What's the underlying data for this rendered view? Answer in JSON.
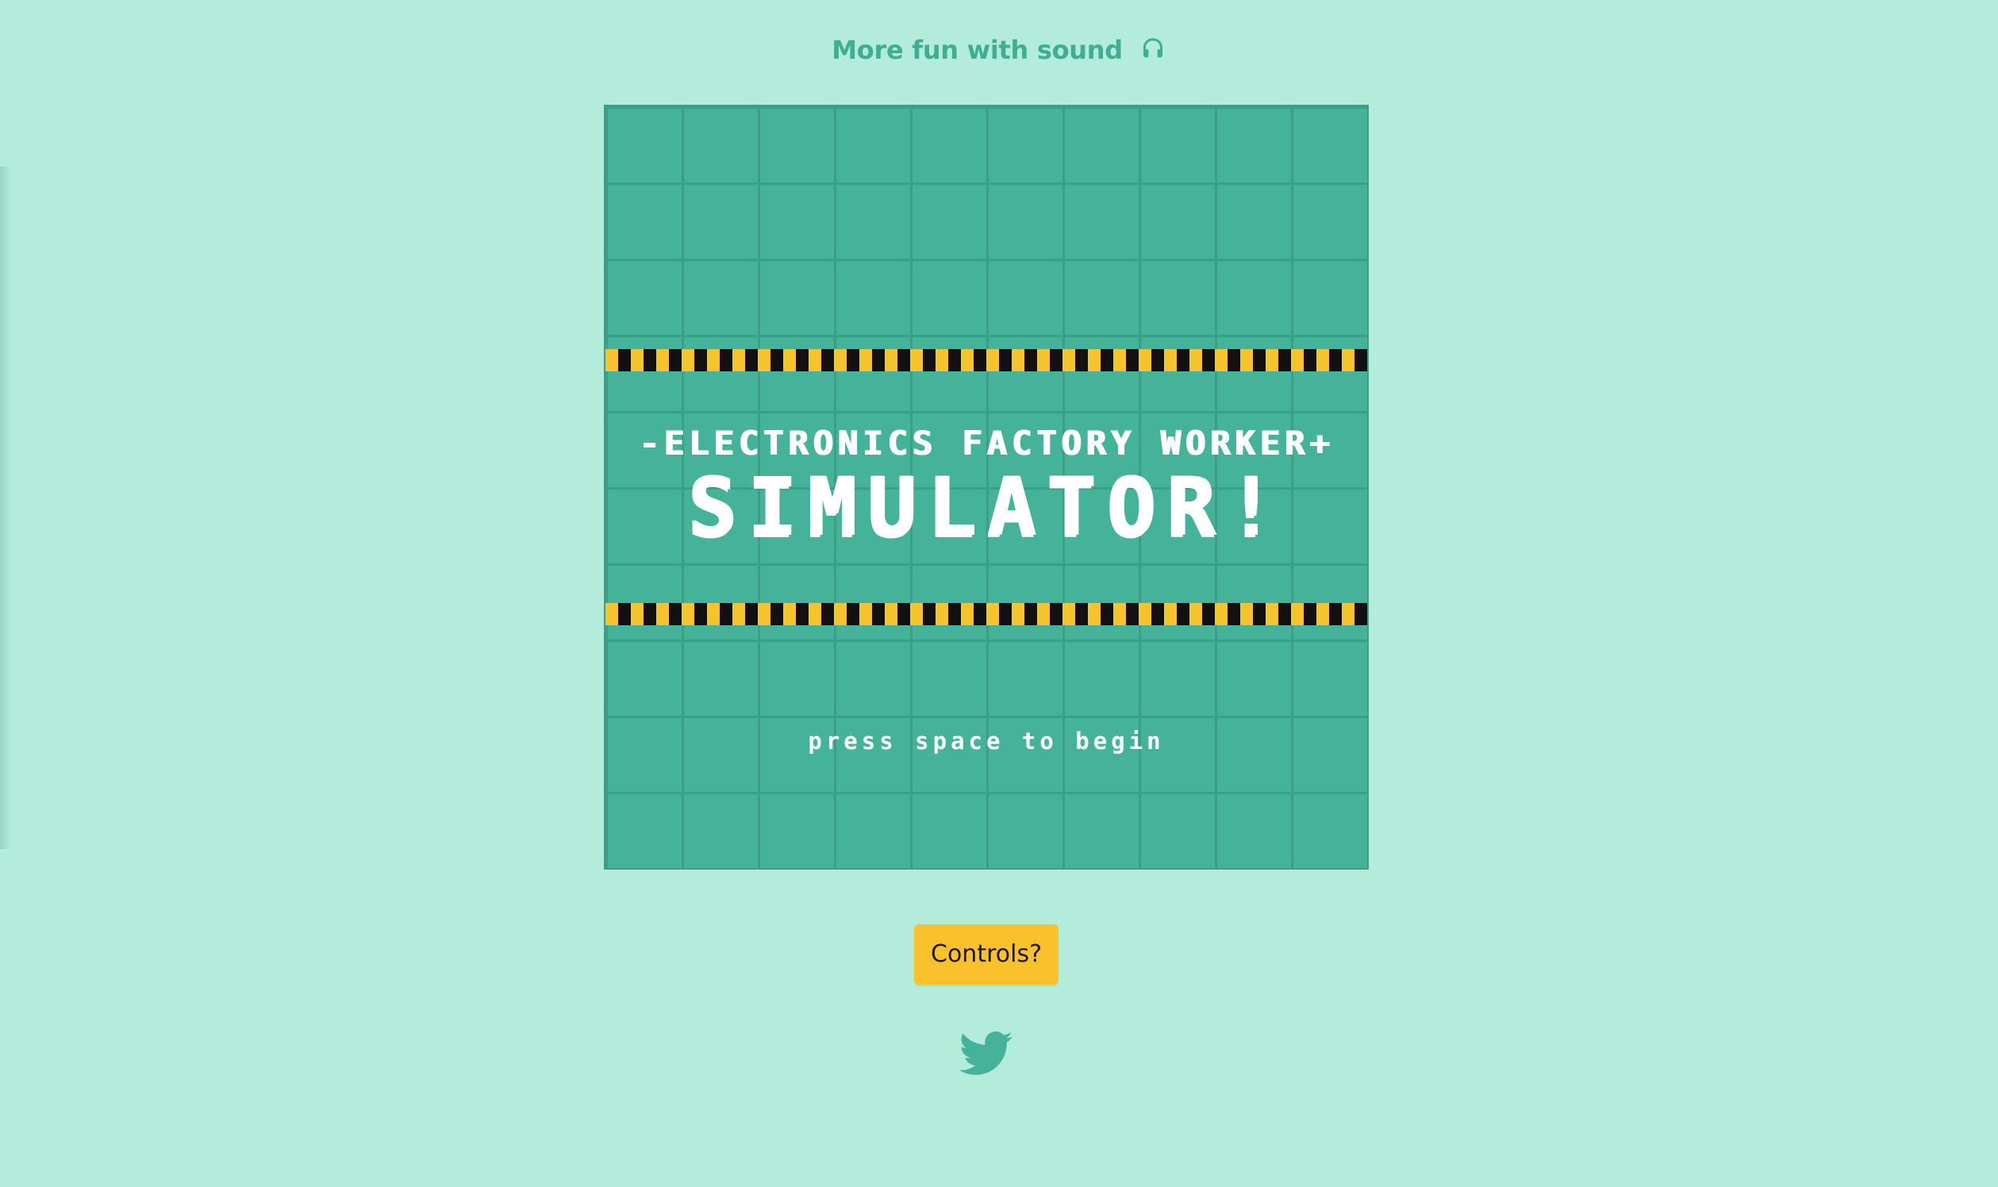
{
  "header": {
    "sound_hint": "More fun with sound",
    "sound_icon": "headphones-icon"
  },
  "game": {
    "title_line1": "-ELECTRONICS FACTORY WORKER+",
    "title_line2": "SIMULATOR!",
    "prompt": "press space to begin",
    "colors": {
      "background": "#45b39a",
      "grid": "#3a9f86",
      "stripe_yellow": "#f7c32b",
      "stripe_black": "#111111",
      "text": "#ffffff"
    }
  },
  "controls": {
    "button_label": "Controls?",
    "color": "#fbc12d"
  },
  "footer": {
    "social_icon": "twitter-icon"
  },
  "page": {
    "background": "#b4ecdc",
    "accent": "#3fae93"
  }
}
